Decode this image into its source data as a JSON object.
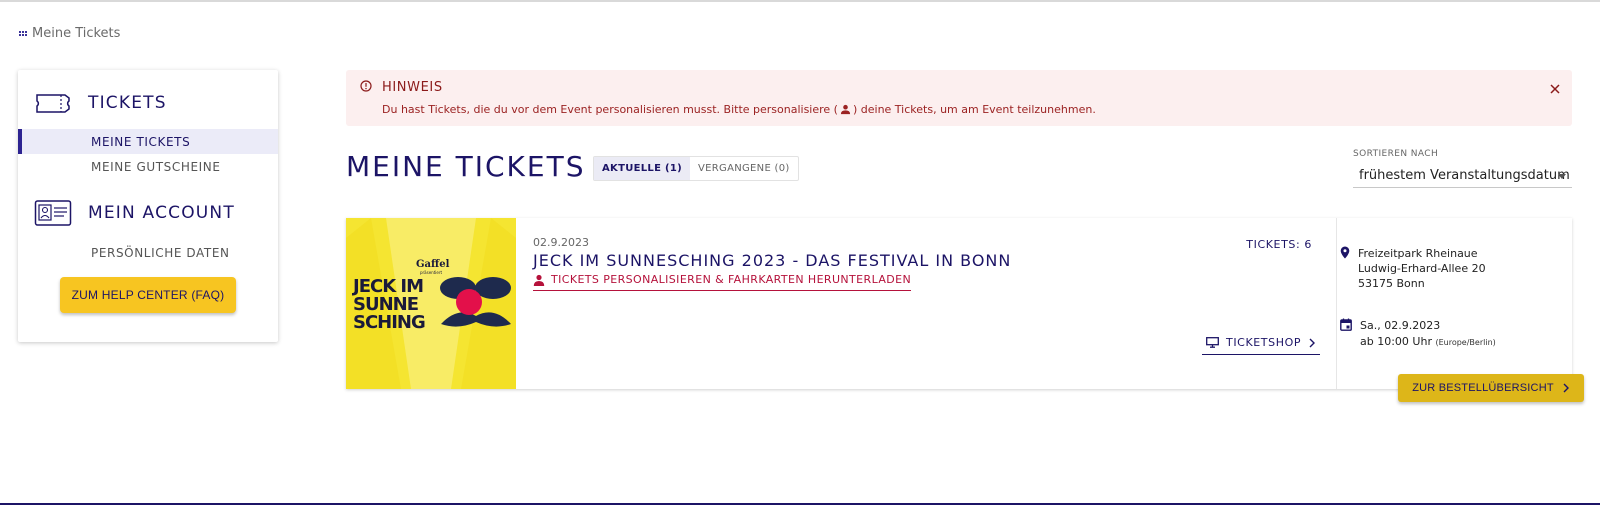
{
  "breadcrumb": {
    "label": "Meine Tickets",
    "icon": "apps-grid-icon"
  },
  "sidebar": {
    "tickets_heading": "TICKETS",
    "items_tickets": [
      {
        "label": "MEINE TICKETS",
        "active": true
      },
      {
        "label": "MEINE GUTSCHEINE",
        "active": false
      }
    ],
    "account_heading": "MEIN ACCOUNT",
    "items_account": [
      {
        "label": "PERSÖNLICHE DATEN",
        "active": false
      }
    ],
    "help_button": "ZUM HELP CENTER (FAQ)"
  },
  "alert": {
    "title": "HINWEIS",
    "message_before": "Du hast Tickets, die du vor dem Event personalisieren musst. Bitte personalisiere (",
    "message_after": ") deine Tickets, um am Event teilzunehmen."
  },
  "main": {
    "title": "MEINE TICKETS",
    "tabs": [
      {
        "label": "AKTUELLE (1)",
        "active": true
      },
      {
        "label": "VERGANGENE (0)",
        "active": false
      }
    ],
    "sort": {
      "label": "SORTIEREN NACH",
      "value": "frühestem Veranstaltungsdatum"
    }
  },
  "ticket": {
    "date": "02.9.2023",
    "title": "JECK IM SUNNESCHING 2023 - DAS FESTIVAL IN BONN",
    "personalize_link": "TICKETS PERSONALISIEREN & FAHRKARTEN HERUNTERLADEN",
    "count": "TICKETS: 6",
    "ticketshop": "TICKETSHOP",
    "location": [
      "Freizeitpark Rheinaue",
      "Ludwig-Erhard-Allee 20",
      "53175 Bonn"
    ],
    "when_date": "Sa., 02.9.2023",
    "when_time": "ab 10:00 Uhr",
    "when_tz": "(Europe/Berlin)",
    "image": {
      "brand": "Gaffel",
      "brand_sub": "präsentiert",
      "lines": [
        "JECK IM",
        "SUNNE",
        "SCHING"
      ]
    }
  },
  "order_button": "ZUR BESTELLÜBERSICHT",
  "colors": {
    "primary": "#1c1466",
    "accent": "#f7c521",
    "alert_bg": "#fcefef",
    "alert_text": "#8b1a1a",
    "link_red": "#b5123b"
  }
}
